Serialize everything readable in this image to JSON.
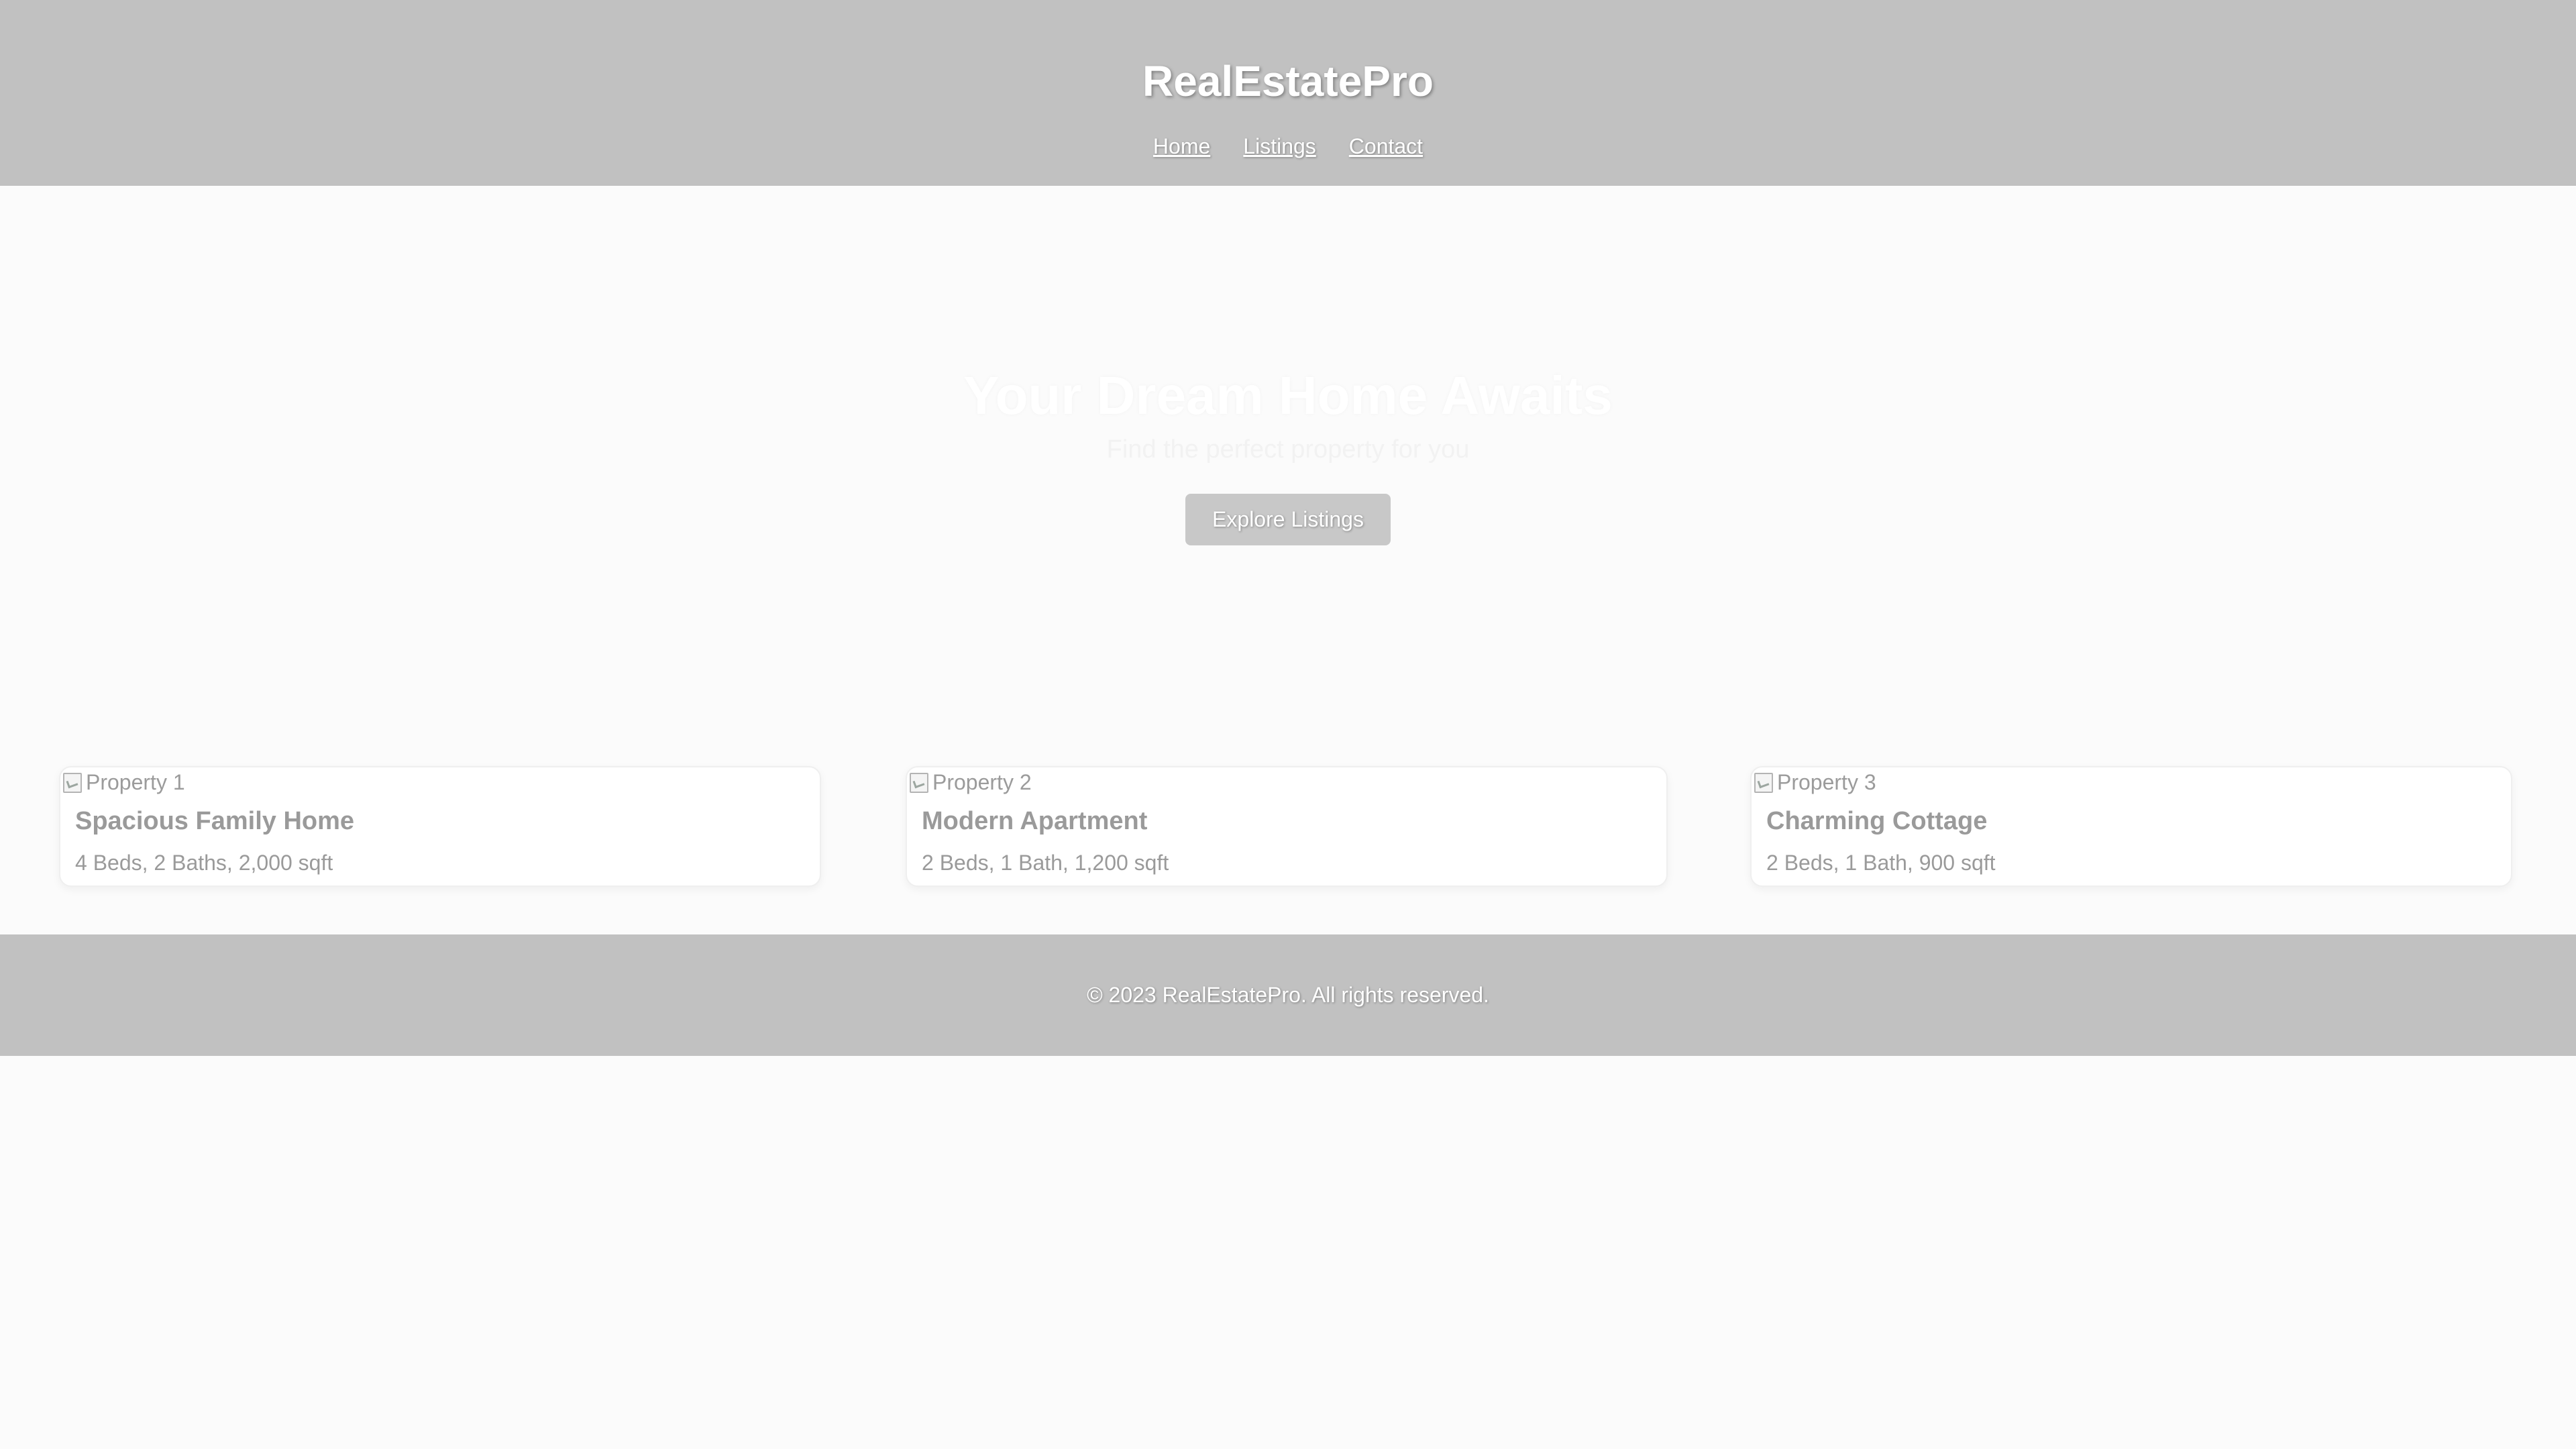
{
  "header": {
    "brand": "RealEstatePro",
    "nav": [
      {
        "label": "Home"
      },
      {
        "label": "Listings"
      },
      {
        "label": "Contact"
      }
    ]
  },
  "hero": {
    "title": "Your Dream Home Awaits",
    "subtitle": "Find the perfect property for you",
    "button_label": "Explore Listings"
  },
  "properties": [
    {
      "image_alt": "Property 1",
      "title": "Spacious Family Home",
      "details": "4 Beds, 2 Baths, 2,000 sqft"
    },
    {
      "image_alt": "Property 2",
      "title": "Modern Apartment",
      "details": "2 Beds, 1 Bath, 1,200 sqft"
    },
    {
      "image_alt": "Property 3",
      "title": "Charming Cottage",
      "details": "2 Beds, 1 Bath, 900 sqft"
    }
  ],
  "footer": {
    "copyright": "© 2023 RealEstatePro. All rights reserved."
  },
  "colors": {
    "header_bg": "#c1c1c1",
    "page_bg": "#fbfbfb",
    "button_bg": "#c8c8c8",
    "text_muted": "#9a9a9a",
    "text_light": "#ffffff"
  },
  "icons": {
    "property_image": "broken-image-icon"
  }
}
